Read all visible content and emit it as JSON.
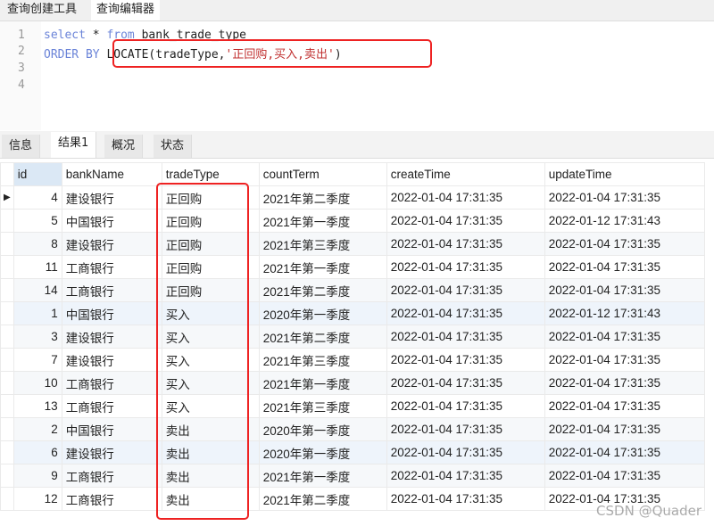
{
  "top_tabs": [
    "查询创建工具",
    "查询编辑器"
  ],
  "editor": {
    "line_numbers": [
      "1",
      "2",
      "3",
      "4"
    ],
    "line1": {
      "kw1": "select",
      "mid": " * ",
      "kw2": "from",
      "rest": " bank_trade_type"
    },
    "line2": {
      "kw": "ORDER BY",
      "func": "LOCATE(tradeType,",
      "str": "'正回购,买入,卖出'",
      "close": ")"
    }
  },
  "result_tabs": [
    "信息",
    "结果1",
    "概况",
    "状态"
  ],
  "columns": [
    "id",
    "bankName",
    "tradeType",
    "countTerm",
    "createTime",
    "updateTime"
  ],
  "rows": [
    [
      "4",
      "建设银行",
      "正回购",
      "2021年第二季度",
      "2022-01-04 17:31:35",
      "2022-01-04 17:31:35"
    ],
    [
      "5",
      "中国银行",
      "正回购",
      "2021年第一季度",
      "2022-01-04 17:31:35",
      "2022-01-12 17:31:43"
    ],
    [
      "8",
      "建设银行",
      "正回购",
      "2021年第三季度",
      "2022-01-04 17:31:35",
      "2022-01-04 17:31:35"
    ],
    [
      "11",
      "工商银行",
      "正回购",
      "2021年第一季度",
      "2022-01-04 17:31:35",
      "2022-01-04 17:31:35"
    ],
    [
      "14",
      "工商银行",
      "正回购",
      "2021年第二季度",
      "2022-01-04 17:31:35",
      "2022-01-04 17:31:35"
    ],
    [
      "1",
      "中国银行",
      "买入",
      "2020年第一季度",
      "2022-01-04 17:31:35",
      "2022-01-12 17:31:43"
    ],
    [
      "3",
      "建设银行",
      "买入",
      "2021年第二季度",
      "2022-01-04 17:31:35",
      "2022-01-04 17:31:35"
    ],
    [
      "7",
      "建设银行",
      "买入",
      "2021年第三季度",
      "2022-01-04 17:31:35",
      "2022-01-04 17:31:35"
    ],
    [
      "10",
      "工商银行",
      "买入",
      "2021年第一季度",
      "2022-01-04 17:31:35",
      "2022-01-04 17:31:35"
    ],
    [
      "13",
      "工商银行",
      "买入",
      "2021年第三季度",
      "2022-01-04 17:31:35",
      "2022-01-04 17:31:35"
    ],
    [
      "2",
      "中国银行",
      "卖出",
      "2020年第一季度",
      "2022-01-04 17:31:35",
      "2022-01-04 17:31:35"
    ],
    [
      "6",
      "建设银行",
      "卖出",
      "2020年第一季度",
      "2022-01-04 17:31:35",
      "2022-01-04 17:31:35"
    ],
    [
      "9",
      "工商银行",
      "卖出",
      "2021年第一季度",
      "2022-01-04 17:31:35",
      "2022-01-04 17:31:35"
    ],
    [
      "12",
      "工商银行",
      "卖出",
      "2021年第二季度",
      "2022-01-04 17:31:35",
      "2022-01-04 17:31:35"
    ]
  ],
  "watermark": "CSDN @Quader"
}
